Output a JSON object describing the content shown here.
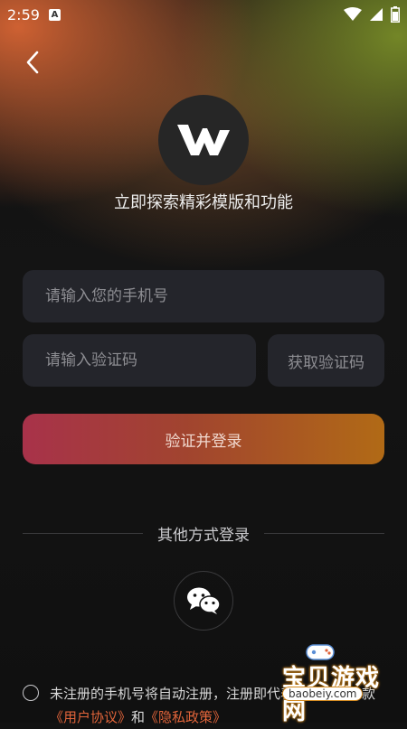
{
  "status_bar": {
    "time": "2:59",
    "notif_letter": "A"
  },
  "logo": {
    "letter": "W"
  },
  "tagline": "立即探索精彩模版和功能",
  "form": {
    "phone_placeholder": "请输入您的手机号",
    "code_placeholder": "请输入验证码",
    "get_code_label": "获取验证码",
    "login_label": "验证并登录"
  },
  "other_login": {
    "label": "其他方式登录"
  },
  "agreement": {
    "text_prefix": "未注册的手机号将自动注册，注册即代表同意以下条款",
    "user_agreement": "《用户协议》",
    "and": "和",
    "privacy_policy": "《隐私政策》"
  },
  "watermark": {
    "title": "宝贝游戏网",
    "url": "baobeiy.com"
  },
  "colors": {
    "link": "#e0643a",
    "login_start": "#a8324a",
    "login_end": "#b16a16"
  }
}
